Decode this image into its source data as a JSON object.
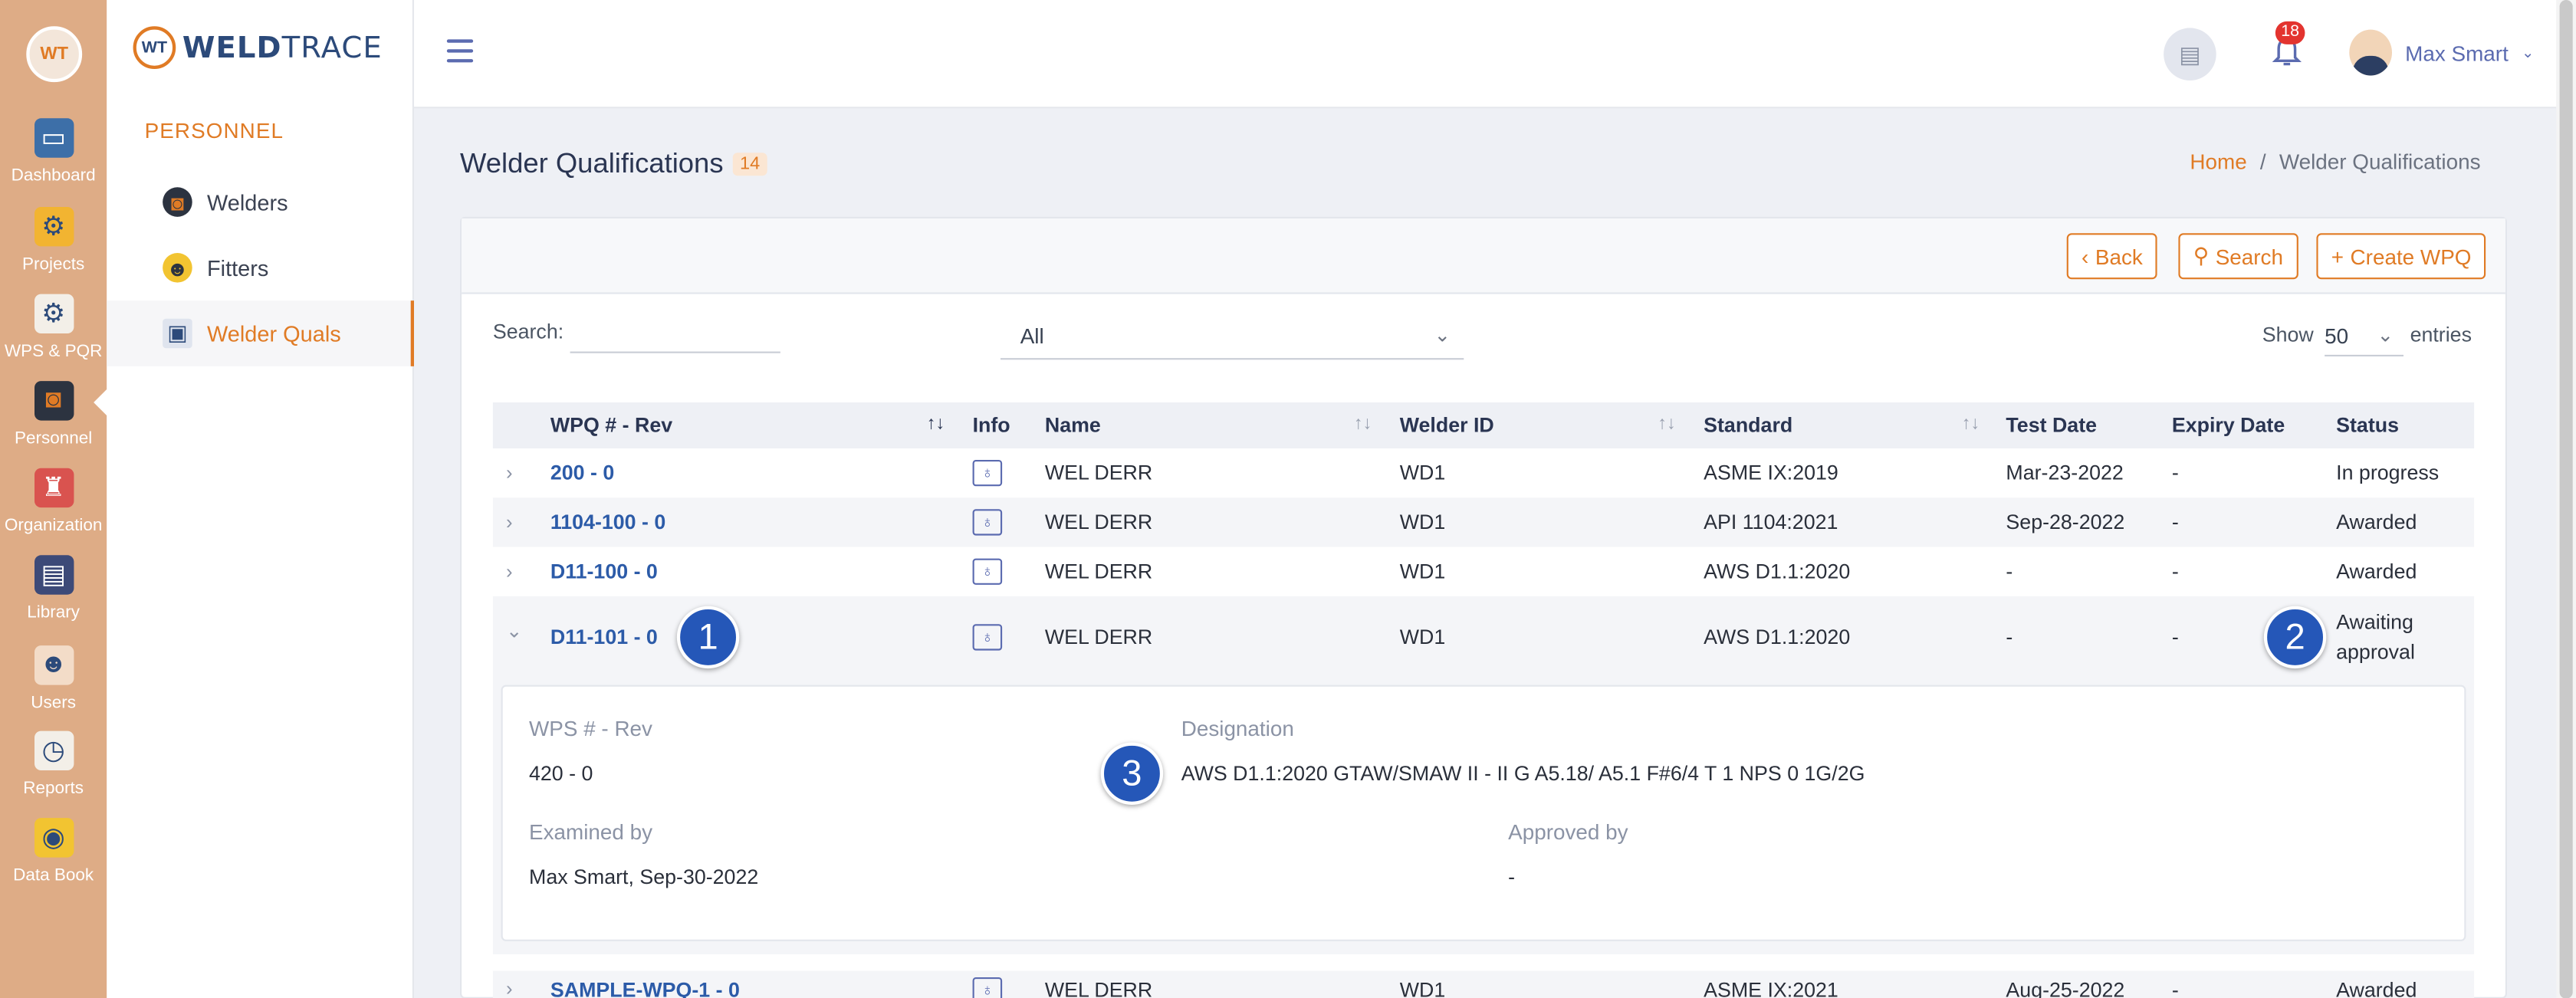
{
  "rail": {
    "logo": "WT",
    "items": [
      {
        "label": "Dashboard",
        "icon": "monitor-icon"
      },
      {
        "label": "Projects",
        "icon": "folder-gear-icon"
      },
      {
        "label": "WPS & PQR",
        "icon": "clipboard-gear-icon"
      },
      {
        "label": "Personnel",
        "icon": "welder-mask-icon"
      },
      {
        "label": "Organization",
        "icon": "org-chart-icon"
      },
      {
        "label": "Library",
        "icon": "open-book-icon"
      },
      {
        "label": "Users",
        "icon": "users-icon"
      },
      {
        "label": "Reports",
        "icon": "report-clock-icon"
      },
      {
        "label": "Data Book",
        "icon": "data-book-icon"
      }
    ]
  },
  "subnav": {
    "brand_mark": "WT",
    "brand_weld": "WELD",
    "brand_trace": "TRACE",
    "section": "PERSONNEL",
    "items": [
      {
        "label": "Welders"
      },
      {
        "label": "Fitters"
      },
      {
        "label": "Welder Quals"
      }
    ]
  },
  "topbar": {
    "notifications": "18",
    "user_name": "Max Smart"
  },
  "page": {
    "title": "Welder Qualifications",
    "count": "14",
    "breadcrumb_home": "Home",
    "breadcrumb_sep": "/",
    "breadcrumb_current": "Welder Qualifications"
  },
  "actions": {
    "back": "Back",
    "search": "Search",
    "create": "Create WPQ"
  },
  "filters": {
    "search_label": "Search:",
    "search_value": "",
    "status_filter": "All",
    "show_label": "Show",
    "page_size": "50",
    "entries_label": "entries"
  },
  "table": {
    "headers": [
      "WPQ # - Rev",
      "Info",
      "Name",
      "Welder ID",
      "Standard",
      "Test Date",
      "Expiry Date",
      "Status"
    ],
    "rows": [
      {
        "wpq": "200 - 0",
        "name": "WEL DERR",
        "welder_id": "WD1",
        "standard": "ASME IX:2019",
        "test_date": "Mar-23-2022",
        "expiry": "-",
        "status": "In progress"
      },
      {
        "wpq": "1104-100 - 0",
        "name": "WEL DERR",
        "welder_id": "WD1",
        "standard": "API 1104:2021",
        "test_date": "Sep-28-2022",
        "expiry": "-",
        "status": "Awarded"
      },
      {
        "wpq": "D11-100 - 0",
        "name": "WEL DERR",
        "welder_id": "WD1",
        "standard": "AWS D1.1:2020",
        "test_date": "-",
        "expiry": "-",
        "status": "Awarded"
      },
      {
        "wpq": "D11-101 - 0",
        "name": "WEL DERR",
        "welder_id": "WD1",
        "standard": "AWS D1.1:2020",
        "test_date": "-",
        "expiry": "-",
        "status_line1": "Awaiting",
        "status_line2": "approval"
      },
      {
        "wpq": "SAMPLE-WPQ-1 - 0",
        "name": "WEL DERR",
        "welder_id": "WD1",
        "standard": "ASME IX:2021",
        "test_date": "Aug-25-2022",
        "expiry": "-",
        "status": "Awarded"
      }
    ],
    "detail": {
      "wps_label": "WPS # - Rev",
      "wps_value": "420 - 0",
      "designation_label": "Designation",
      "designation_value": "AWS D1.1:2020 GTAW/SMAW II - II G A5.18/ A5.1 F#6/4 T 1 NPS 0 1G/2G",
      "examined_label": "Examined by",
      "examined_value": "Max Smart, Sep-30-2022",
      "approved_label": "Approved by",
      "approved_value": "-"
    }
  },
  "markers": [
    "1",
    "2",
    "3"
  ]
}
